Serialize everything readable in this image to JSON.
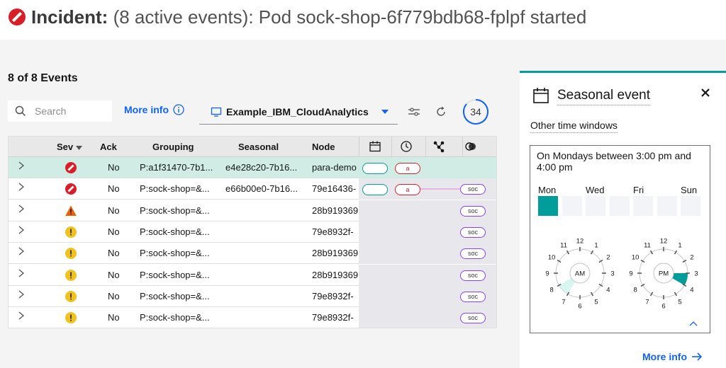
{
  "header": {
    "title_bold": "Incident:",
    "title_rest": " (8 active events): Pod sock-shop-6f779bdb68-fplpf started"
  },
  "toolbar": {
    "events_count": "8 of 8 Events",
    "search_placeholder": "Search",
    "more_info": "More info",
    "datasource": "Example_IBM_CloudAnalytics",
    "counter": "34"
  },
  "table": {
    "headers": {
      "sev": "Sev",
      "ack": "Ack",
      "grouping": "Grouping",
      "seasonal": "Seasonal",
      "node": "Node"
    },
    "rows": [
      {
        "sev": "critical",
        "ack": "No",
        "grouping": "P:a1f31470-7b1...",
        "seasonal": "e4e28c20-7b16...",
        "node": "para-demo",
        "cal": true,
        "a": true,
        "soc": false,
        "line": false
      },
      {
        "sev": "critical",
        "ack": "No",
        "grouping": "P:sock-shop=&...",
        "seasonal": "e66b00e0-7b16...",
        "node": "79e16436-",
        "cal": true,
        "a": true,
        "soc": true,
        "line": true
      },
      {
        "sev": "major",
        "ack": "No",
        "grouping": "P:sock-shop=&...",
        "seasonal": "",
        "node": "28b919369",
        "cal": false,
        "a": false,
        "soc": true,
        "line": false
      },
      {
        "sev": "minor",
        "ack": "No",
        "grouping": "P:sock-shop=&...",
        "seasonal": "",
        "node": "79e8932f-",
        "cal": false,
        "a": false,
        "soc": true,
        "line": false
      },
      {
        "sev": "minor",
        "ack": "No",
        "grouping": "P:sock-shop=&...",
        "seasonal": "",
        "node": "28b919369",
        "cal": false,
        "a": false,
        "soc": true,
        "line": false
      },
      {
        "sev": "minor",
        "ack": "No",
        "grouping": "P:sock-shop=&...",
        "seasonal": "",
        "node": "28b919369",
        "cal": false,
        "a": false,
        "soc": true,
        "line": false
      },
      {
        "sev": "minor",
        "ack": "No",
        "grouping": "P:sock-shop=&...",
        "seasonal": "",
        "node": "79e8932f-",
        "cal": false,
        "a": false,
        "soc": true,
        "line": false
      },
      {
        "sev": "minor",
        "ack": "No",
        "grouping": "P:sock-shop=&...",
        "seasonal": "",
        "node": "79e8932f-",
        "cal": false,
        "a": false,
        "soc": true,
        "line": false
      }
    ],
    "pill_a_label": "a",
    "pill_soc_label": "soc"
  },
  "panel": {
    "title": "Seasonal event",
    "other_windows": "Other time windows",
    "description": "On Mondays between 3:00 pm and 4:00 pm",
    "days": [
      {
        "label": "Mon",
        "active": true
      },
      {
        "label": "",
        "active": false
      },
      {
        "label": "Wed",
        "active": false
      },
      {
        "label": "",
        "active": false
      },
      {
        "label": "Fri",
        "active": false
      },
      {
        "label": "",
        "active": false
      },
      {
        "label": "Sun",
        "active": false
      }
    ],
    "clocks": [
      {
        "label": "AM",
        "highlight_hour": 7,
        "fill": "#d8f5f1"
      },
      {
        "label": "PM",
        "highlight_hour": 3,
        "fill": "#009d9a"
      }
    ],
    "hour_labels": [
      "12",
      "1",
      "2",
      "3",
      "4",
      "5",
      "6",
      "7",
      "8",
      "9",
      "10",
      "11"
    ],
    "more_info": "More info"
  },
  "colors": {
    "accent": "#009d9a",
    "critical": "#da1e28",
    "major": "#eb6200",
    "minor": "#f1c21b",
    "link": "#0f62fe"
  }
}
